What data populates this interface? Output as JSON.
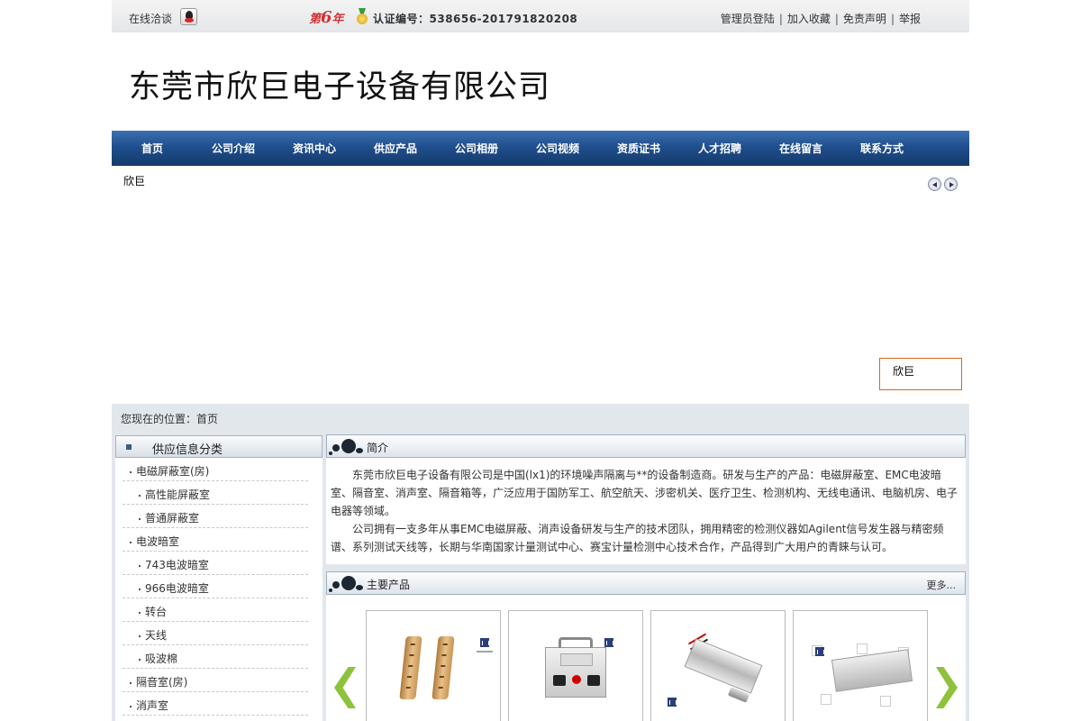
{
  "topbar": {
    "chat_label": "在线洽谈",
    "year_prefix": "第",
    "year_num": "6",
    "year_suffix": "年",
    "cert_label": "认证编号：538656-201791820208",
    "links": [
      "管理员登陆",
      "加入收藏",
      "免责声明",
      "举报"
    ]
  },
  "header": {
    "company": "东莞市欣巨电子设备有限公司"
  },
  "nav": {
    "items": [
      "首页",
      "公司介绍",
      "资讯中心",
      "供应产品",
      "公司相册",
      "公司视频",
      "资质证书",
      "人才招聘",
      "在线留言",
      "联系方式"
    ]
  },
  "banner": {
    "caption": "欣巨",
    "float_text": "欣巨"
  },
  "breadcrumb": "您现在的位置：首页",
  "sidebar": {
    "title": "供应信息分类",
    "categories": [
      {
        "label": "电磁屏蔽室(房)",
        "level": 1
      },
      {
        "label": "高性能屏蔽室",
        "level": 2
      },
      {
        "label": "普通屏蔽室",
        "level": 2
      },
      {
        "label": "电波暗室",
        "level": 1
      },
      {
        "label": "743电波暗室",
        "level": 2
      },
      {
        "label": "966电波暗室",
        "level": 2
      },
      {
        "label": "转台",
        "level": 2
      },
      {
        "label": "天线",
        "level": 2
      },
      {
        "label": "吸波棉",
        "level": 2
      },
      {
        "label": "隔音室(房)",
        "level": 1
      },
      {
        "label": "消声室",
        "level": 1
      }
    ]
  },
  "intro": {
    "title": "简介",
    "p1": "东莞市欣巨电子设备有限公司是中国(lx1)的环境噪声隔离与**的设备制造商。研发与生产的产品：电磁屏蔽室、EMC电波暗室、隔音室、消声室、隔音箱等，广泛应用于国防军工、航空航天、涉密机关、医疗卫生、检测机构、无线电通讯、电脑机房、电子电器等领域。",
    "p2": "公司拥有一支多年从事EMC电磁屏蔽、消声设备研发与生产的技术团队，拥用精密的检测仪器如Agilent信号发生器与精密频谱、系列测试天线等，长期与华南国家计量测试中心、赛宝计量检测中心技术合作，产品得到广大用户的青睐与认可。"
  },
  "products": {
    "title": "主要产品",
    "more": "更多..."
  },
  "colors": {
    "nav_top": "#3d70b0",
    "nav_bottom": "#153a6c",
    "accent_green": "#8fc23c",
    "float_border": "#d2691e"
  }
}
